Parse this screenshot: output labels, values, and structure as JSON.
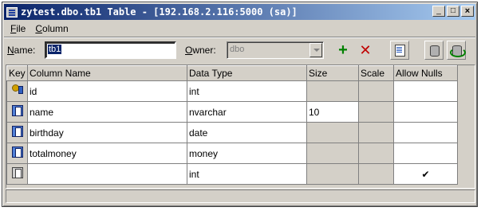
{
  "window": {
    "title": "zytest.dbo.tb1 Table - [192.168.2.116:5000 (sa)]",
    "minimize_glyph": "_",
    "maximize_glyph": "□",
    "close_glyph": "×"
  },
  "menu": {
    "file": {
      "accel": "F",
      "rest": "ile"
    },
    "column": {
      "accel": "C",
      "rest": "olumn"
    }
  },
  "toolbar": {
    "name_label_accel": "N",
    "name_label_rest": "ame:",
    "name_value": "tb1",
    "owner_label_accel": "O",
    "owner_label_rest": "wner:",
    "owner_value": "dbo",
    "add_glyph": "+",
    "delete_glyph": "✕"
  },
  "grid": {
    "headers": [
      "Key",
      "Column Name",
      "Data Type",
      "Size",
      "Scale",
      "Allow Nulls"
    ],
    "rows": [
      {
        "icon": "primary-key-icon",
        "name": "id",
        "type": "int",
        "size": "",
        "scale": "",
        "nulls": ""
      },
      {
        "icon": "column-icon",
        "name": "name",
        "type": "nvarchar",
        "size": "10",
        "scale": "",
        "nulls": ""
      },
      {
        "icon": "column-icon",
        "name": "birthday",
        "type": "date",
        "size": "",
        "scale": "",
        "nulls": ""
      },
      {
        "icon": "column-icon",
        "name": "totalmoney",
        "type": "money",
        "size": "",
        "scale": "",
        "nulls": ""
      },
      {
        "icon": "new-column-icon",
        "name": "",
        "type": "int",
        "size": "",
        "scale": "",
        "nulls": "✔"
      }
    ]
  },
  "colors": {
    "title_start": "#0a246a",
    "title_end": "#a6caf0",
    "chrome": "#d4d0c8",
    "add": "#008000",
    "delete": "#c00000"
  }
}
